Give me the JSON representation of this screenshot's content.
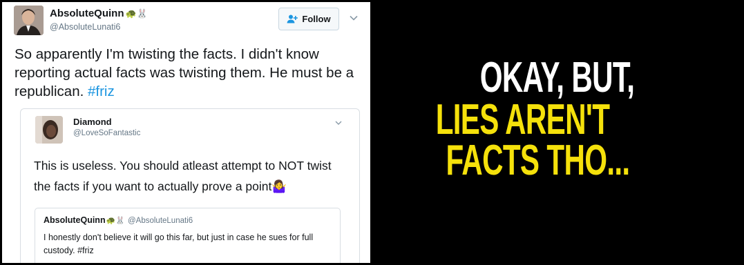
{
  "tweet": {
    "author": {
      "name": "AbsoluteQuinn",
      "emoji": "🐢🐰",
      "handle": "@AbsoluteLunati6"
    },
    "follow_label": "Follow",
    "text": "So apparently I'm twisting the facts. I didn't know reporting actual facts was twisting them. He must be a republican.",
    "hashtag": "#friz",
    "colors": {
      "link": "#1b95e0",
      "text": "#14171a",
      "muted": "#657786"
    }
  },
  "quoted": {
    "author": {
      "name": "Diamond",
      "handle": "@LoveSoFantastic"
    },
    "text": "This is useless. You should atleast attempt to NOT twist the facts if you want to actually prove a point",
    "text_emoji": "🤷‍♀️",
    "inner": {
      "name": "AbsoluteQuinn",
      "emoji": "🐢🐰",
      "handle": "@AbsoluteLunati6",
      "text": "I honestly don't believe it will go this far, but just in case he sues for full custody. #friz"
    }
  },
  "meme": {
    "line1": "OKAY, BUT,",
    "line2": "LIES AREN'T",
    "line3": "FACTS THO...",
    "colors": {
      "line1": "#ffffff",
      "line2": "#f5e10b",
      "background": "#000000"
    }
  }
}
